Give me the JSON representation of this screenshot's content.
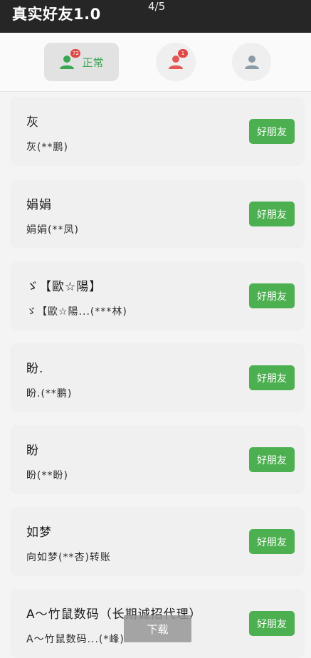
{
  "header": {
    "title": "真实好友1.0",
    "page_indicator": "4/5"
  },
  "tabs": [
    {
      "icon": "person-icon",
      "badge": "72",
      "label": "正常",
      "color": "#3aa651",
      "selected": true
    },
    {
      "icon": "person-icon",
      "badge": "1",
      "label": "",
      "color": "#e35757",
      "selected": false
    },
    {
      "icon": "person-icon",
      "badge": "",
      "label": "",
      "color": "#8a9aa6",
      "selected": false
    }
  ],
  "friends": [
    {
      "name": "灰",
      "detail": "灰(**鹏)",
      "button": "好朋友"
    },
    {
      "name": "娟娟",
      "detail": "娟娟(**凤)",
      "button": "好朋友"
    },
    {
      "name": "ゞ【歐☆陽】",
      "detail": "ゞ【歐☆陽...(***林)",
      "button": "好朋友"
    },
    {
      "name": "盼.",
      "detail": "盼.(**鹏)",
      "button": "好朋友"
    },
    {
      "name": "盼",
      "detail": "盼(**盼)",
      "button": "好朋友"
    },
    {
      "name": "如梦",
      "detail": "向如梦(**杏)转账",
      "button": "好朋友"
    },
    {
      "name": "A～竹鼠数码（长期诚招代理）",
      "detail": "A～竹鼠数码...(*峰)",
      "button": "好朋友"
    }
  ],
  "download_button": "下载",
  "colors": {
    "accent": "#4caf50",
    "header_bg": "#262626",
    "badge": "#e04848"
  }
}
